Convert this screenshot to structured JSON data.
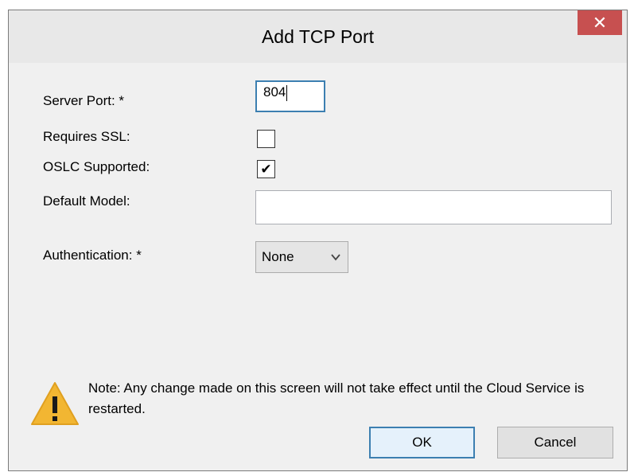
{
  "window": {
    "title": "Add TCP Port",
    "close_glyph": "✕"
  },
  "form": {
    "server_port": {
      "label": "Server Port:  *",
      "value": "804"
    },
    "requires_ssl": {
      "label": "Requires SSL:",
      "checked": false
    },
    "oslc_supported": {
      "label": "OSLC Supported:",
      "checked": true,
      "check_glyph": "✔"
    },
    "default_model": {
      "label": "Default Model:",
      "value": ""
    },
    "authentication": {
      "label": "Authentication:  *",
      "selected": "None",
      "arrow_glyph": "⌄"
    }
  },
  "note": {
    "text": "Note: Any change made on this screen will not take effect until the Cloud Service is restarted.",
    "icon": "warning-icon",
    "icon_color": "#f2b632"
  },
  "buttons": {
    "ok_label": "OK",
    "cancel_label": "Cancel"
  },
  "colors": {
    "close_button": "#c75050",
    "focus_border": "#3c7fb1"
  }
}
